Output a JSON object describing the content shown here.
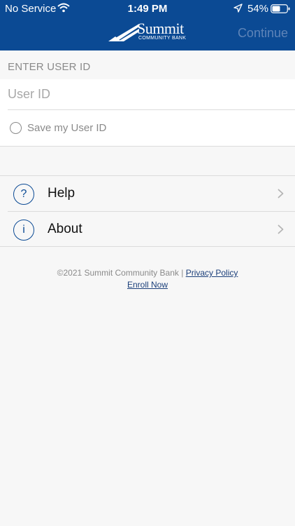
{
  "status_bar": {
    "carrier": "No Service",
    "time": "1:49 PM",
    "battery": "54%"
  },
  "header": {
    "logo_name": "Summit",
    "logo_sub": "COMMUNITY BANK",
    "continue_label": "Continue"
  },
  "form": {
    "section_label": "ENTER USER ID",
    "user_id_placeholder": "User ID",
    "user_id_value": "",
    "save_label": "Save my User ID"
  },
  "menu": {
    "items": [
      {
        "label": "Help",
        "icon": "question-icon",
        "glyph": "?"
      },
      {
        "label": "About",
        "icon": "info-icon",
        "glyph": "i"
      }
    ]
  },
  "footer": {
    "copyright": "©2021 Summit Community Bank",
    "separator": "|",
    "privacy_label": "Privacy Policy",
    "enroll_label": "Enroll Now"
  },
  "colors": {
    "brand_blue": "#0b4a94",
    "continue_disabled": "#5e84b8",
    "background": "#f7f7f7"
  }
}
